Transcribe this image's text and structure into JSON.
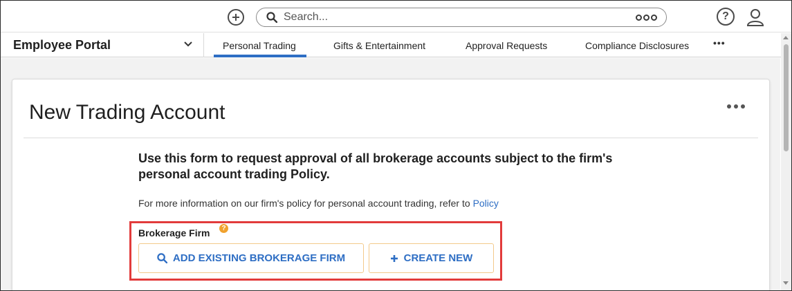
{
  "topbar": {
    "add_icon": "plus-circle-icon",
    "search_placeholder": "Search...",
    "search_options_icon": "options-icon",
    "help_icon": "question-circle-icon",
    "user_icon": "user-icon"
  },
  "nav": {
    "portal_title": "Employee Portal",
    "tabs": [
      {
        "label": "Personal Trading",
        "active": true
      },
      {
        "label": "Gifts & Entertainment",
        "active": false
      },
      {
        "label": "Approval Requests",
        "active": false
      },
      {
        "label": "Compliance Disclosures",
        "active": false
      }
    ],
    "more_label": "•••"
  },
  "page": {
    "title": "New Trading Account",
    "intro": "Use this form to request approval of all brokerage accounts subject to the firm's personal account trading Policy.",
    "info_text": "For more information on our firm's policy for personal account trading, refer to",
    "info_link": "Policy",
    "field_label": "Brokerage Firm",
    "help_badge": "?",
    "add_existing_label": "ADD EXISTING BROKERAGE FIRM",
    "create_new_label": "CREATE NEW"
  },
  "colors": {
    "accent": "#2e6ec4",
    "highlight": "#e23b3b",
    "help_badge": "#f0a22e"
  }
}
